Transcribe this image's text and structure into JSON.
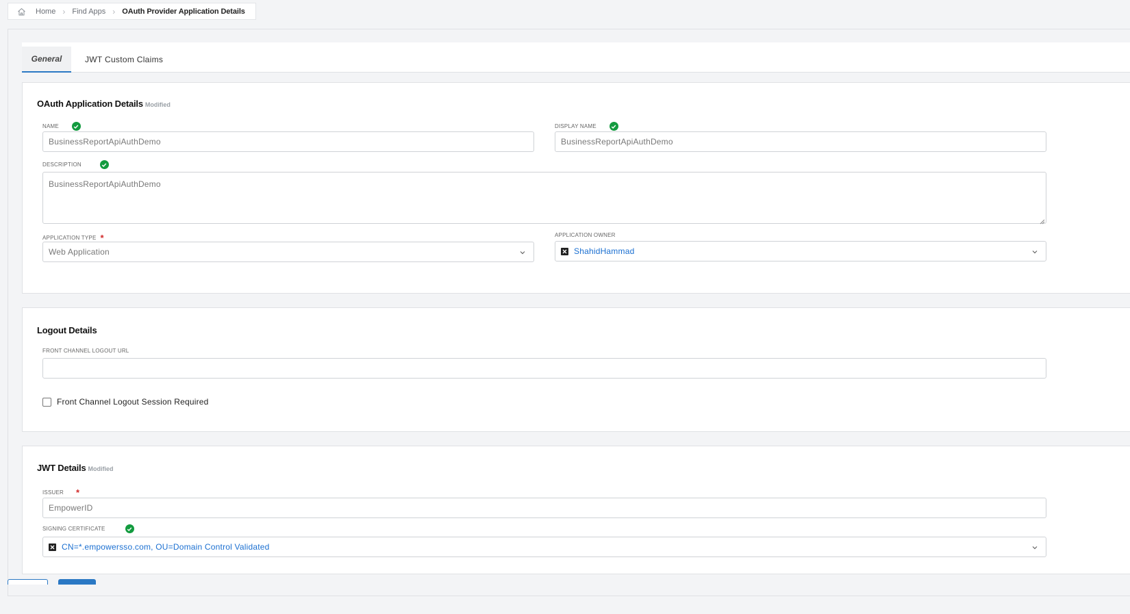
{
  "breadcrumb": {
    "home": "Home",
    "find_apps": "Find Apps",
    "current": "OAuth Provider Application Details"
  },
  "tabs": [
    {
      "label": "General",
      "active": true
    },
    {
      "label": "JWT Custom Claims",
      "active": false
    }
  ],
  "oauth_section": {
    "title": "OAuth Application Details",
    "badge": "Modified",
    "name_label": "NAME",
    "name_value": "BusinessReportApiAuthDemo",
    "display_name_label": "DISPLAY NAME",
    "display_name_value": "BusinessReportApiAuthDemo",
    "description_label": "DESCRIPTION",
    "description_value": "BusinessReportApiAuthDemo",
    "app_type_label": "APPLICATION TYPE",
    "app_type_value": "Web Application",
    "app_owner_label": "APPLICATION OWNER",
    "app_owner_value": "ShahidHammad"
  },
  "logout_section": {
    "title": "Logout Details",
    "front_channel_label": "FRONT CHANNEL LOGOUT URL",
    "front_channel_value": "",
    "session_required_label": "Front Channel Logout Session Required"
  },
  "jwt_section": {
    "title": "JWT Details",
    "badge": "Modified",
    "issuer_label": "ISSUER",
    "issuer_value": "EmpowerID",
    "signing_cert_label": "SIGNING CERTIFICATE",
    "signing_cert_value": "CN=*.empowersso.com, OU=Domain Control Validated"
  },
  "colors": {
    "accent": "#2a78c4",
    "valid": "#139b3f",
    "required": "#d12a2a",
    "link": "#1a6fd1"
  }
}
